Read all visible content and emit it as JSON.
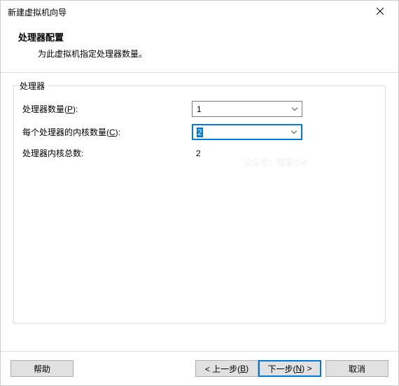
{
  "window": {
    "title": "新建虚拟机向导"
  },
  "header": {
    "title": "处理器配置",
    "subtitle": "为此虚拟机指定处理器数量。"
  },
  "fieldset": {
    "legend": "处理器"
  },
  "form": {
    "processors": {
      "label_pre": "处理器数量(",
      "label_u": "P",
      "label_post": "):",
      "value": "1"
    },
    "cores": {
      "label_pre": "每个处理器的内核数量(",
      "label_u": "C",
      "label_post": "):",
      "value": "2"
    },
    "total": {
      "label": "处理器内核总数:",
      "value": "2"
    }
  },
  "watermark": "公众号：管家小e",
  "footer": {
    "help": "帮助",
    "back_pre": "< 上一步(",
    "back_u": "B",
    "back_post": ")",
    "next_pre": "下一步(",
    "next_u": "N",
    "next_post": ") >",
    "cancel": "取消"
  }
}
